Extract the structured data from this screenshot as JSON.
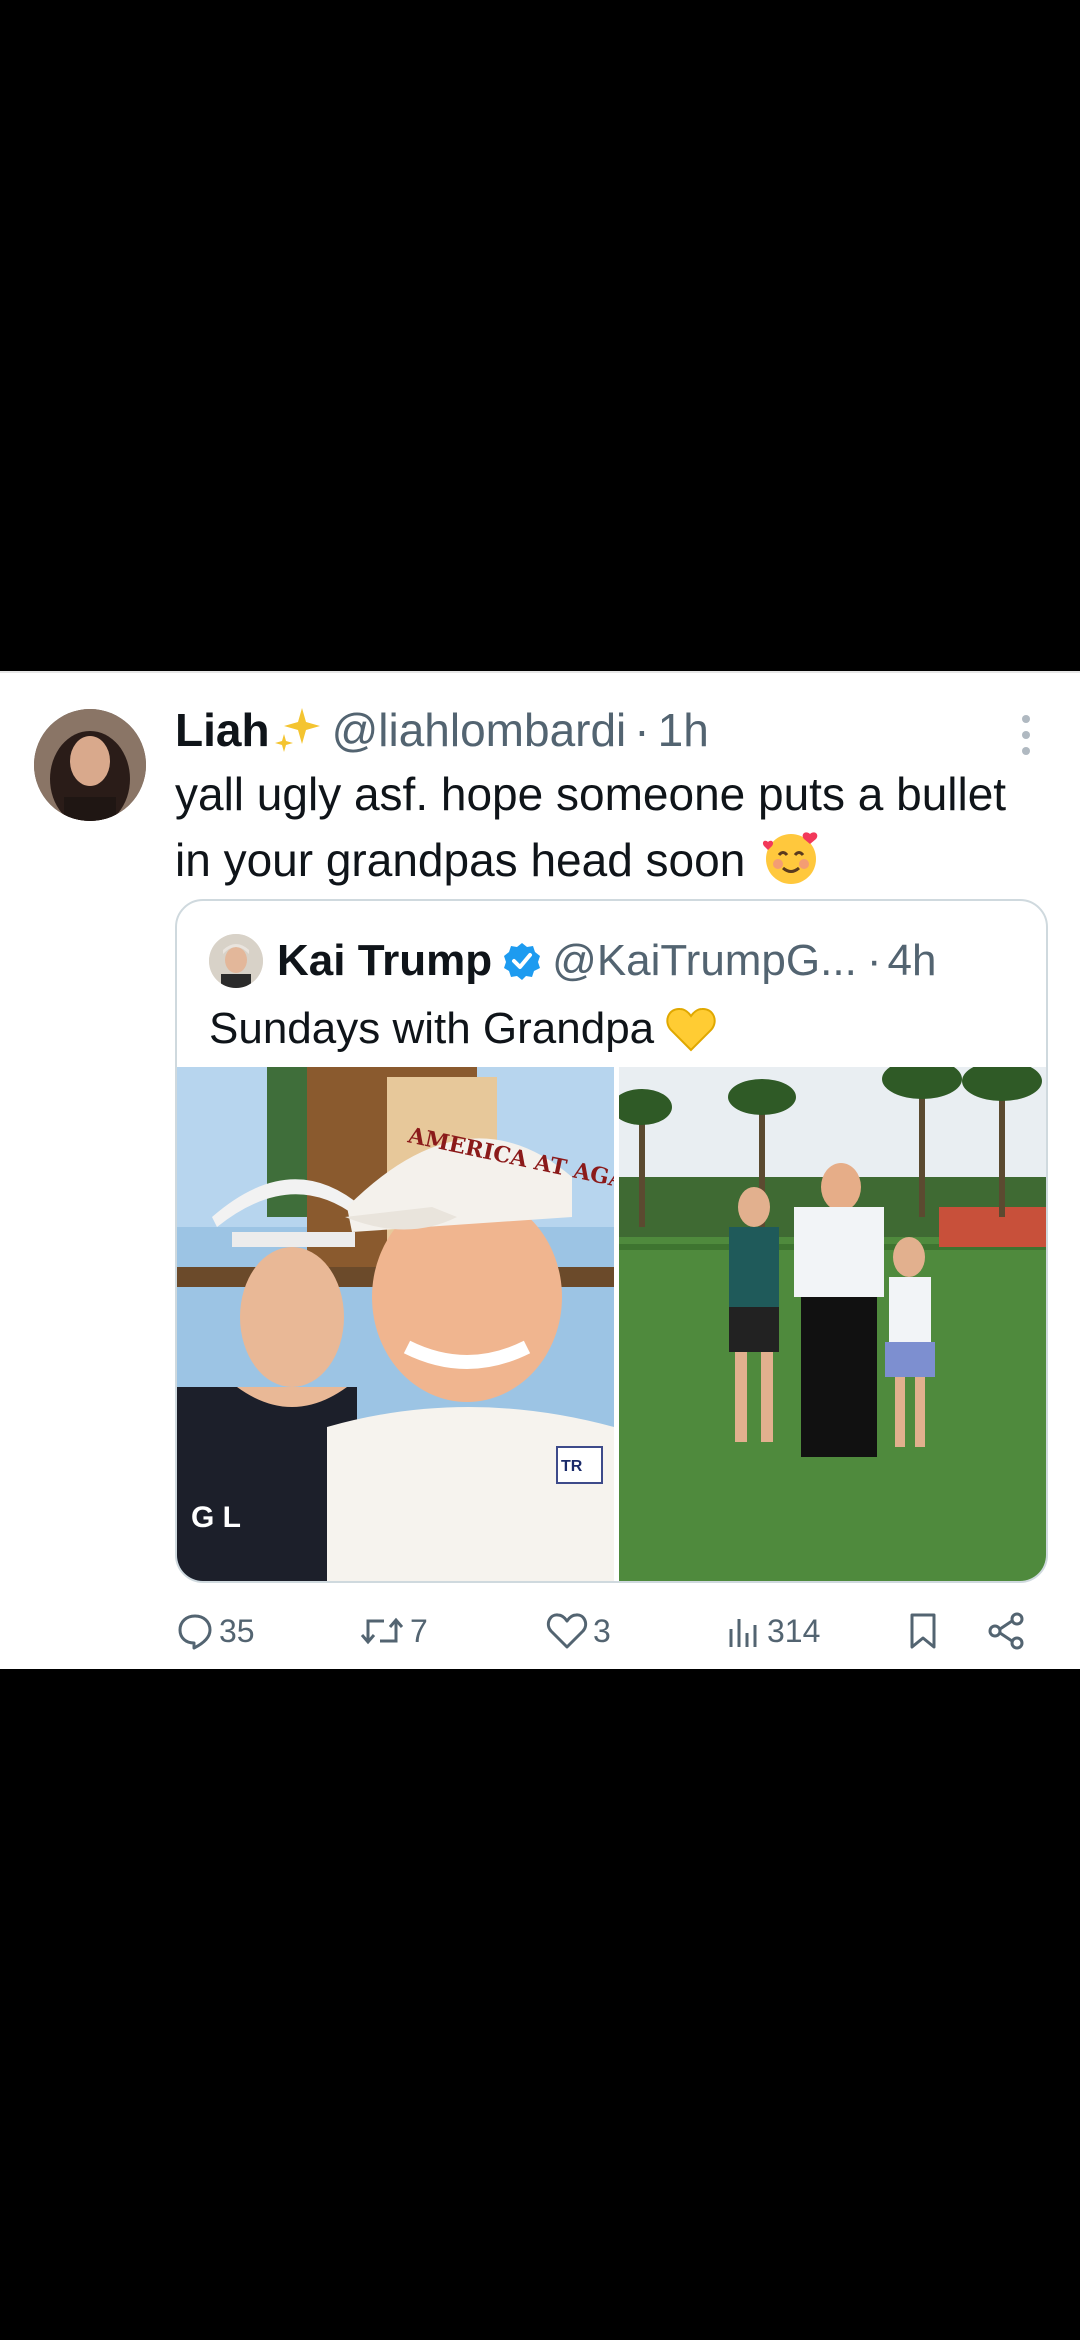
{
  "tweet": {
    "author_name": "Liah",
    "author_handle": "@liahlombardi",
    "separator": "·",
    "time": "1h",
    "text": "yall ugly asf. hope someone puts a bullet in your grandpas head soon"
  },
  "quoted": {
    "author_name": "Kai Trump",
    "author_handle": "@KaiTrumpG...",
    "separator": "·",
    "time": "4h",
    "text": "Sundays with Grandpa",
    "photo_left_hat_text": "AMERICA AT AGAIN",
    "photo_left_shirt_text": "G L",
    "photo_left_badge_text": "TR"
  },
  "actions": {
    "replies": "35",
    "reposts": "7",
    "likes": "3",
    "views": "314"
  },
  "colors": {
    "text": "#0f1419",
    "secondary": "#536471",
    "verified": "#1d9bf0",
    "border": "#cfd9de"
  },
  "icons": [
    "sparkles-icon",
    "more-icon",
    "verified-icon",
    "yellow-heart-icon",
    "smiling-hearts-emoji-icon",
    "reply-icon",
    "repost-icon",
    "like-icon",
    "views-icon",
    "bookmark-icon",
    "share-icon"
  ]
}
